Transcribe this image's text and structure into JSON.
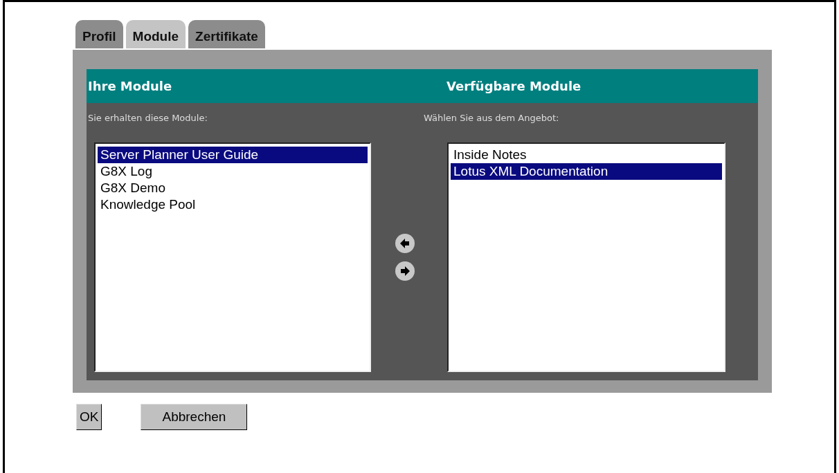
{
  "tabs": [
    {
      "label": "Profil",
      "selected": false
    },
    {
      "label": "Module",
      "selected": true
    },
    {
      "label": "Zertifikate",
      "selected": false
    }
  ],
  "columns": [
    {
      "heading": "Ihre Module",
      "hint": "Sie erhalten diese Module:",
      "items": [
        {
          "label": "Server Planner User Guide",
          "selected": true
        },
        {
          "label": "G8X Log",
          "selected": false
        },
        {
          "label": "G8X Demo",
          "selected": false
        },
        {
          "label": "Knowledge Pool",
          "selected": false
        }
      ]
    },
    {
      "heading": "Verfügbare Module",
      "hint": "Wählen Sie aus dem Angebot:",
      "items": [
        {
          "label": "Inside Notes",
          "selected": false
        },
        {
          "label": "Lotus XML Documentation",
          "selected": true
        }
      ]
    }
  ],
  "buttons": [
    "OK",
    "Abbrechen"
  ]
}
